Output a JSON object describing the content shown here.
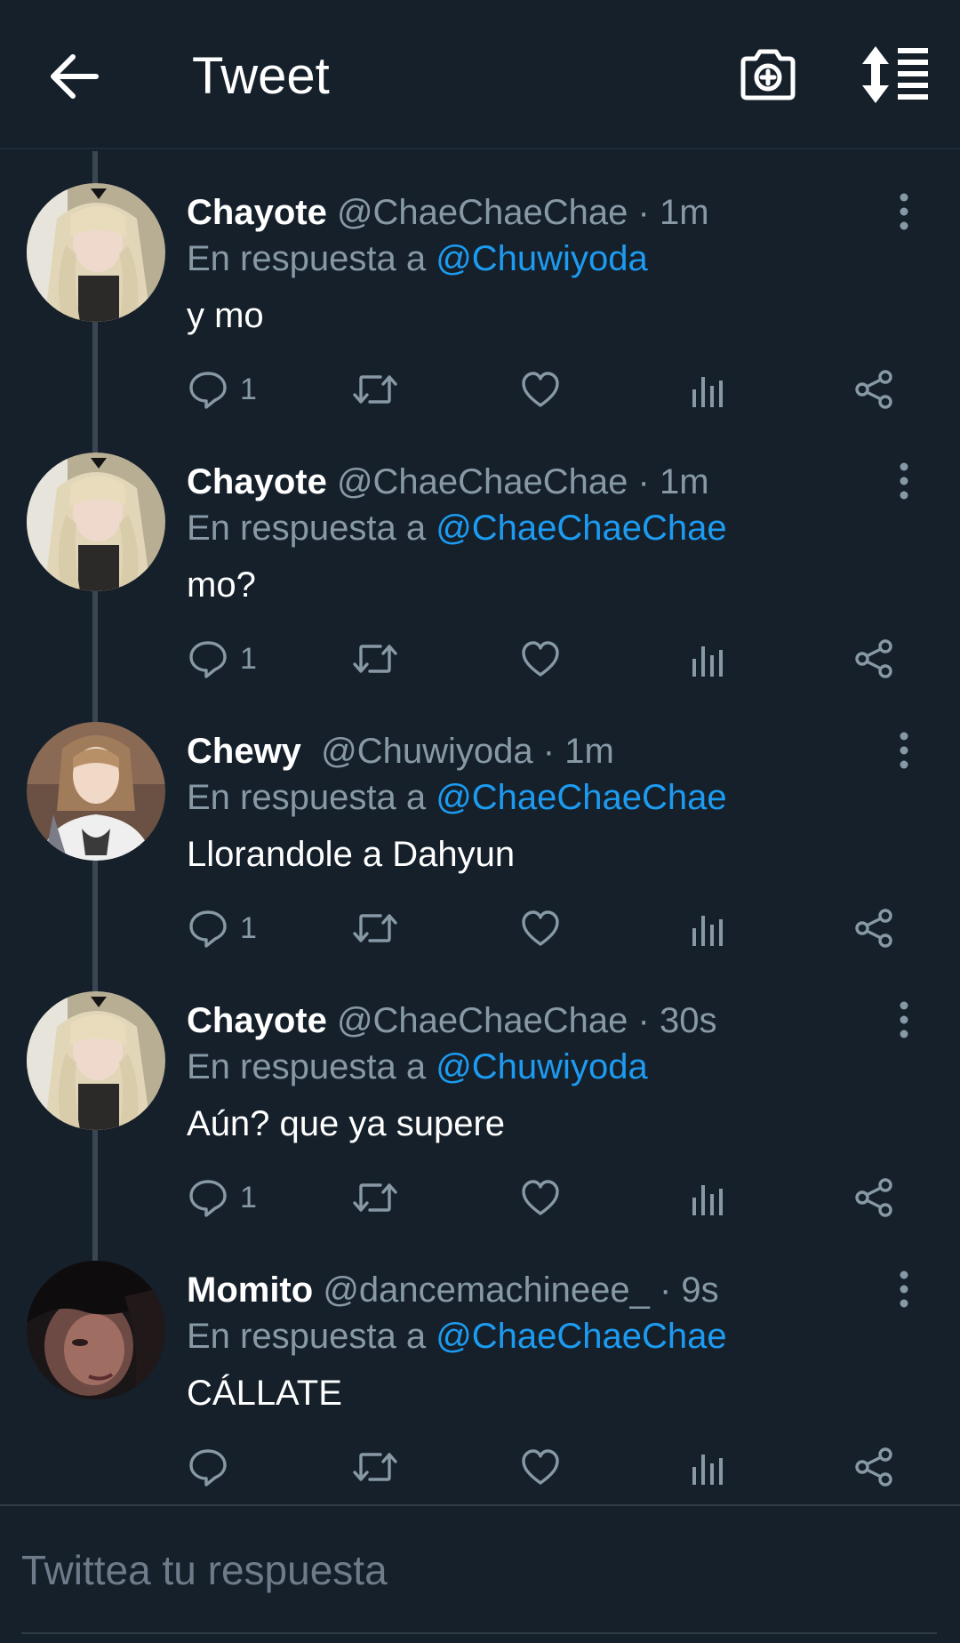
{
  "header": {
    "title": "Tweet",
    "back_icon": "arrow-left-icon",
    "camera_icon": "camera-add-icon",
    "sort_icon": "sort-icon"
  },
  "tweets": [
    {
      "name": "Chayote",
      "handle": "@ChaeChaeChae · 1m",
      "reply_prefix": "En respuesta a ",
      "reply_to": "@Chuwiyoda",
      "text": "y mo",
      "reply_count": "1",
      "avatar": "blonde"
    },
    {
      "name": "Chayote",
      "handle": "@ChaeChaeChae · 1m",
      "reply_prefix": "En respuesta a ",
      "reply_to": "@ChaeChaeChae",
      "text": "mo?",
      "reply_count": "1",
      "avatar": "blonde"
    },
    {
      "name": "Chewy",
      "handle": "@Chuwiyoda · 1m",
      "reply_prefix": "En respuesta a ",
      "reply_to": "@ChaeChaeChae",
      "text": "Llorandole a Dahyun",
      "reply_count": "1",
      "avatar": "brunette"
    },
    {
      "name": "Chayote",
      "handle": "@ChaeChaeChae · 30s",
      "reply_prefix": "En respuesta a ",
      "reply_to": "@Chuwiyoda",
      "text": "Aún? que ya supere",
      "reply_count": "1",
      "avatar": "blonde"
    },
    {
      "name": "Momito",
      "handle": "@dancemachineee_ · 9s",
      "reply_prefix": "En respuesta a ",
      "reply_to": "@ChaeChaeChae",
      "text": "CÁLLATE",
      "reply_count": "",
      "avatar": "dark"
    }
  ],
  "compose": {
    "placeholder": "Twittea tu respuesta"
  },
  "colors": {
    "background": "#15202b",
    "accent": "#1d9bf0",
    "muted": "#8899a6"
  }
}
